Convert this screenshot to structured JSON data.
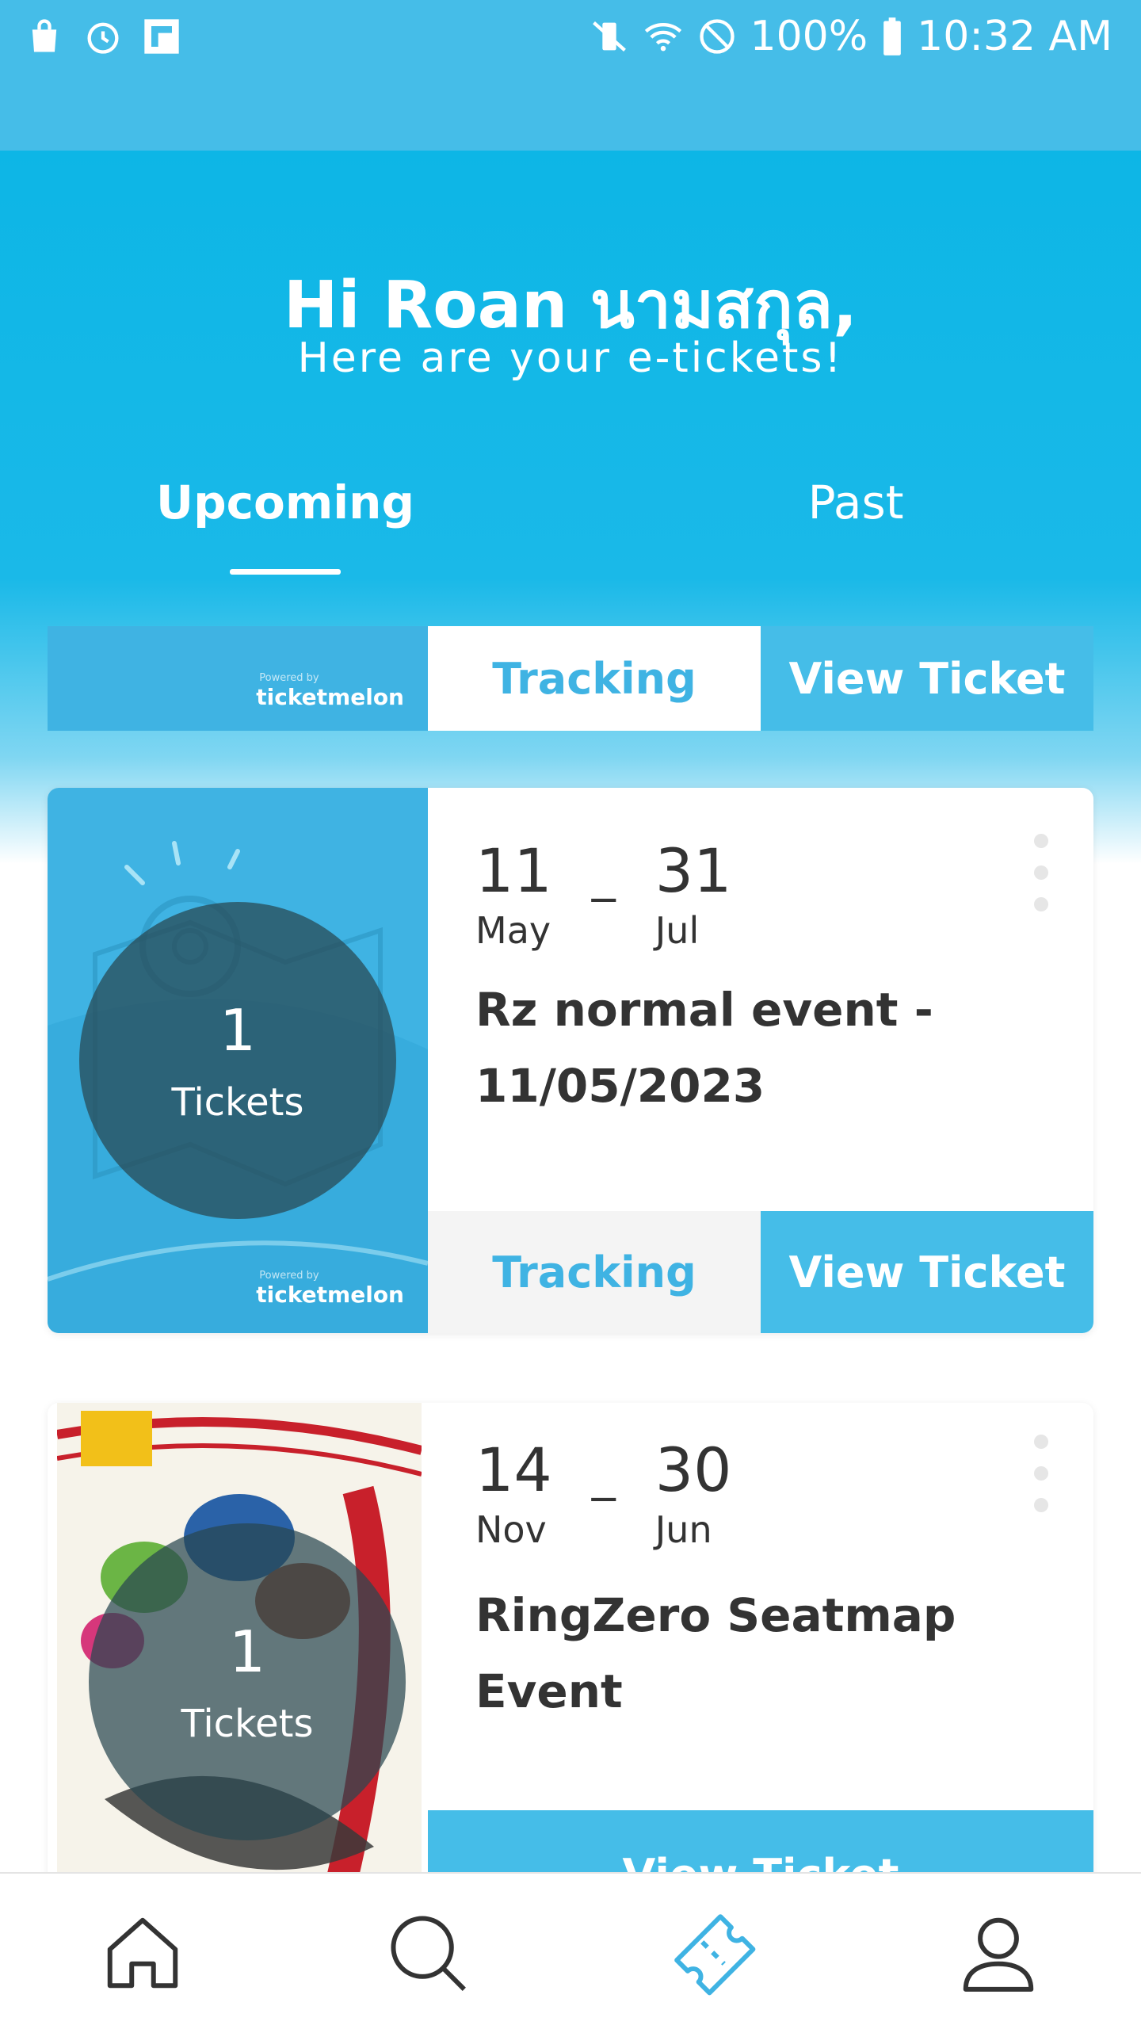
{
  "status_bar": {
    "battery": "100%",
    "time": "10:32 AM",
    "icons": [
      "shopping-bag-icon",
      "alarm-icon",
      "flipboard-icon",
      "vibrate-icon",
      "wifi-icon",
      "do-not-disturb-icon",
      "battery-icon"
    ]
  },
  "header": {
    "greeting": "Hi Roan นามสกุล,",
    "subtitle": "Here are your e-tickets!"
  },
  "tabs": [
    {
      "label": "Upcoming",
      "active": true
    },
    {
      "label": "Past",
      "active": false
    }
  ],
  "brand": {
    "powered_by": "Powered by",
    "name": "ticketmelon"
  },
  "tickets": [
    {
      "partial": true,
      "tracking_label": "Tracking",
      "view_label": "View Ticket"
    },
    {
      "start_day": "11",
      "start_month": "May",
      "separator": "_",
      "end_day": "31",
      "end_month": "Jul",
      "title": "Rz normal event - 11/05/2023",
      "count": "1",
      "count_label": "Tickets",
      "tracking_label": "Tracking",
      "view_label": "View Ticket"
    },
    {
      "start_day": "14",
      "start_month": "Nov",
      "separator": "_",
      "end_day": "30",
      "end_month": "Jun",
      "title": "RingZero Seatmap Event",
      "count": "1",
      "count_label": "Tickets",
      "view_label": "View Ticket"
    }
  ],
  "bottom_nav": [
    "home-icon",
    "search-icon",
    "ticket-icon",
    "profile-icon"
  ],
  "colors": {
    "primary": "#45bde8",
    "header": "#0db6e6",
    "text": "#333333"
  }
}
